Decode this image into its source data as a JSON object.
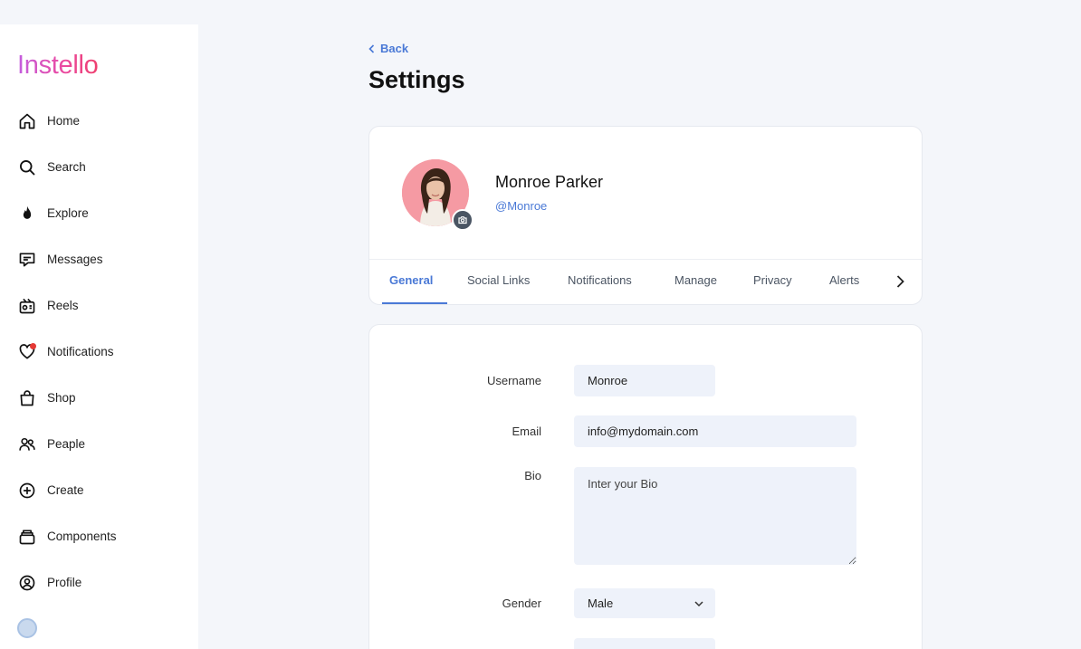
{
  "app": {
    "logo": "Instello"
  },
  "sidebar": {
    "items": [
      {
        "label": "Home",
        "icon": "home-icon"
      },
      {
        "label": "Search",
        "icon": "search-icon"
      },
      {
        "label": "Explore",
        "icon": "fire-icon"
      },
      {
        "label": "Messages",
        "icon": "message-icon"
      },
      {
        "label": "Reels",
        "icon": "reels-icon"
      },
      {
        "label": "Notifications",
        "icon": "heart-icon"
      },
      {
        "label": "Shop",
        "icon": "bag-icon"
      },
      {
        "label": "Peaple",
        "icon": "people-icon"
      },
      {
        "label": "Create",
        "icon": "plus-circle-icon"
      },
      {
        "label": "Components",
        "icon": "components-icon"
      },
      {
        "label": "Profile",
        "icon": "profile-icon"
      }
    ]
  },
  "header": {
    "back_label": "Back",
    "title": "Settings"
  },
  "profile": {
    "name": "Monroe Parker",
    "handle": "@Monroe"
  },
  "tabs": [
    {
      "label": "General",
      "active": true
    },
    {
      "label": "Social Links"
    },
    {
      "label": "Notifications"
    },
    {
      "label": "Manage"
    },
    {
      "label": "Privacy"
    },
    {
      "label": "Alerts"
    }
  ],
  "form": {
    "username": {
      "label": "Username",
      "value": "Monroe"
    },
    "email": {
      "label": "Email",
      "value": "info@mydomain.com"
    },
    "bio": {
      "label": "Bio",
      "placeholder": "Inter your Bio"
    },
    "gender": {
      "label": "Gender",
      "value": "Male"
    }
  },
  "colors": {
    "accent": "#4a79d6",
    "background": "#f4f6fa",
    "input_bg": "#eef2fa",
    "notification_dot": "#e53935"
  }
}
